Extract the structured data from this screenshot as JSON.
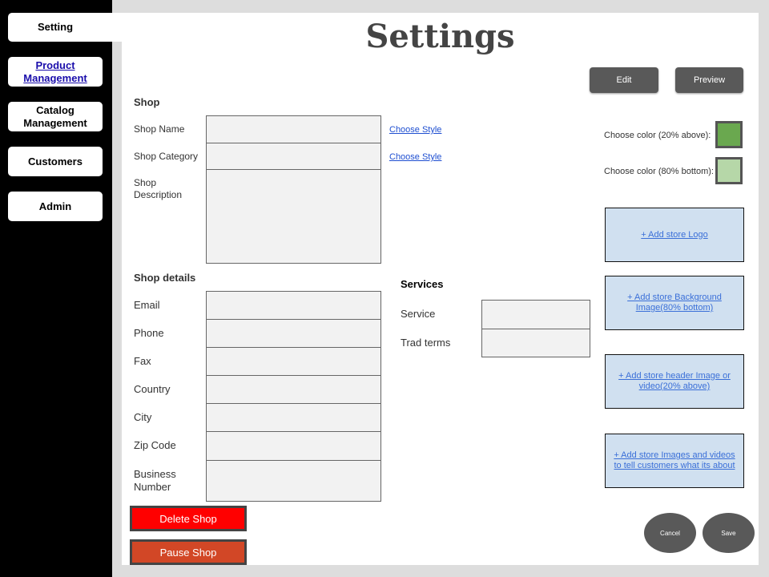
{
  "sidebar": {
    "items": [
      {
        "label": "Setting"
      },
      {
        "label": "Product Management"
      },
      {
        "label": "Catalog Management"
      },
      {
        "label": "Customers"
      },
      {
        "label": "Admin"
      }
    ]
  },
  "header": {
    "title": "Settings",
    "edit_label": "Edit",
    "preview_label": "Preview"
  },
  "shop": {
    "title": "Shop",
    "name_label": "Shop Name",
    "category_label": "Shop Category",
    "description_label": "Shop Description",
    "choose_style_1": "Choose Style",
    "choose_style_2": "Choose Style"
  },
  "colors": {
    "top_label": "Choose color (20% above):",
    "bottom_label": "Choose color (80% bottom):",
    "top_color": "#6aa84f",
    "bottom_color": "#b6d7a8"
  },
  "uploads": {
    "logo": "+ Add store Logo",
    "background": "+ Add store Background Image(80% bottom)",
    "header": "+ Add store header Image or video(20% above)",
    "media": "+ Add store Images and videos to tell customers what its about"
  },
  "details": {
    "title": "Shop details",
    "fields": [
      "Email",
      "Phone",
      "Fax",
      "Country",
      "City",
      "Zip Code",
      "Business Number"
    ]
  },
  "services": {
    "title": "Services",
    "service_label": "Service",
    "trade_label": "Trad terms"
  },
  "actions": {
    "delete_label": "Delete Shop",
    "pause_label": "Pause Shop",
    "cancel_label": "Cancel",
    "save_label": "Save",
    "delete_color": "#ff0000",
    "pause_color": "#d24726"
  }
}
